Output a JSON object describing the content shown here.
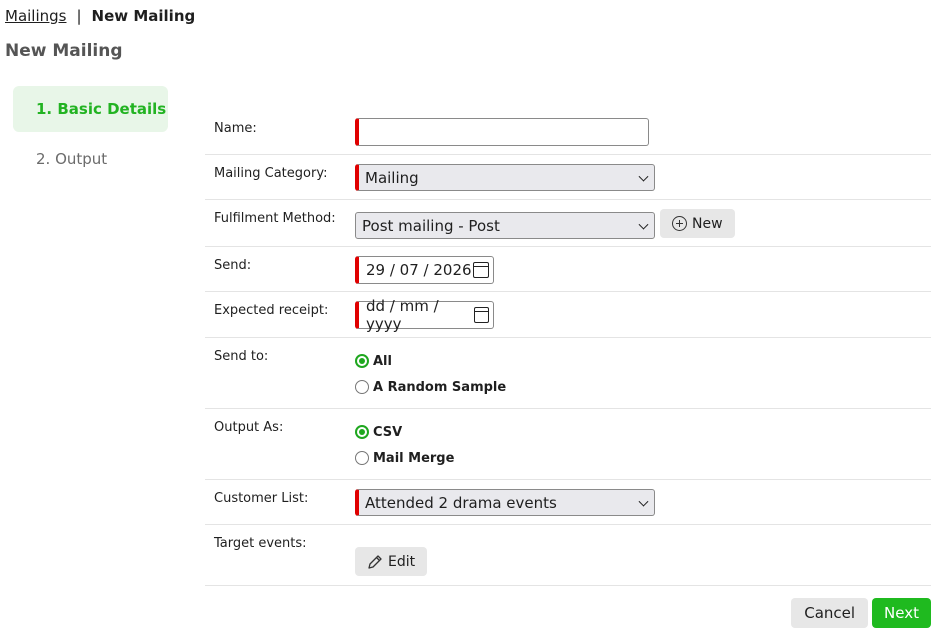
{
  "breadcrumb": {
    "parent": "Mailings",
    "separator": "|",
    "current": "New Mailing"
  },
  "page_title": "New Mailing",
  "steps": [
    {
      "label": "1. Basic Details",
      "active": true
    },
    {
      "label": "2. Output",
      "active": false
    }
  ],
  "form": {
    "name": {
      "label": "Name:",
      "value": ""
    },
    "category": {
      "label": "Mailing Category:",
      "value": "Mailing"
    },
    "fulfilment": {
      "label": "Fulfilment Method:",
      "value": "Post mailing - Post",
      "new_label": "New"
    },
    "send": {
      "label": "Send:",
      "value": "29 / 07 / 2026"
    },
    "expected": {
      "label": "Expected receipt:",
      "placeholder": "dd / mm / yyyy"
    },
    "send_to": {
      "label": "Send to:",
      "options": [
        "All",
        "A Random Sample"
      ],
      "selected": "All"
    },
    "output_as": {
      "label": "Output As:",
      "options": [
        "CSV",
        "Mail Merge"
      ],
      "selected": "CSV"
    },
    "customer_list": {
      "label": "Customer List:",
      "value": "Attended 2 drama events"
    },
    "target_events": {
      "label": "Target events:",
      "edit_label": "Edit"
    }
  },
  "footer": {
    "cancel_label": "Cancel",
    "next_label": "Next"
  },
  "colors": {
    "accent": "#1fba1f",
    "required": "#e00000",
    "active_step_bg": "#e8f6e8"
  },
  "icons": {
    "calendar": "calendar-icon",
    "plus": "plus-circle-icon",
    "edit": "pencil-icon",
    "dropdown": "chevron-down-icon"
  }
}
